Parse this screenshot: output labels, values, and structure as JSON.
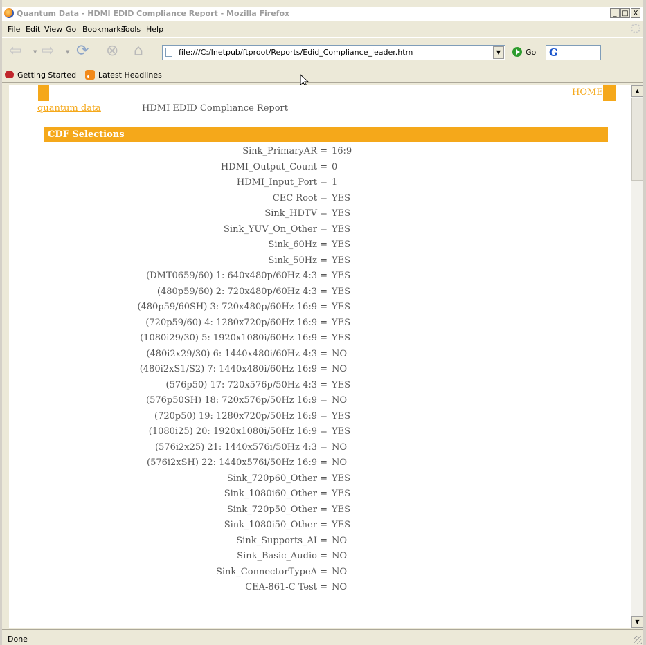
{
  "window": {
    "title": "Quantum Data - HDMI EDID Compliance Report - Mozilla Firefox",
    "controls": [
      "_",
      "□",
      "X"
    ]
  },
  "menu": [
    "File",
    "Edit",
    "View",
    "Go",
    "Bookmarks",
    "Tools",
    "Help"
  ],
  "toolbar": {
    "url": "file:///C:/Inetpub/ftproot/Reports/Edid_Compliance_leader.htm",
    "go_label": "Go",
    "search_logo": "G"
  },
  "bookmarks": [
    "Getting Started",
    "Latest Headlines"
  ],
  "page": {
    "home_link": "HOME",
    "brand": "quantum data",
    "report_title": "HDMI EDID Compliance Report",
    "section_title": "CDF Selections",
    "rows": [
      {
        "label": "Sink_PrimaryAR =",
        "value": "16:9"
      },
      {
        "label": "HDMI_Output_Count =",
        "value": "0"
      },
      {
        "label": "HDMI_Input_Port =",
        "value": "1"
      },
      {
        "label": "CEC Root =",
        "value": "YES"
      },
      {
        "label": "Sink_HDTV =",
        "value": "YES"
      },
      {
        "label": "Sink_YUV_On_Other =",
        "value": "YES"
      },
      {
        "label": "Sink_60Hz =",
        "value": "YES"
      },
      {
        "label": "Sink_50Hz =",
        "value": "YES"
      },
      {
        "label": "(DMT0659/60) 1: 640x480p/60Hz 4:3 =",
        "value": "YES"
      },
      {
        "label": "(480p59/60) 2: 720x480p/60Hz 4:3 =",
        "value": "YES"
      },
      {
        "label": "(480p59/60SH) 3: 720x480p/60Hz 16:9 =",
        "value": "YES"
      },
      {
        "label": "(720p59/60) 4: 1280x720p/60Hz 16:9 =",
        "value": "YES"
      },
      {
        "label": "(1080i29/30) 5: 1920x1080i/60Hz 16:9 =",
        "value": "YES"
      },
      {
        "label": "(480i2x29/30) 6: 1440x480i/60Hz 4:3 =",
        "value": "NO"
      },
      {
        "label": "(480i2xS1/S2) 7: 1440x480i/60Hz 16:9 =",
        "value": "NO"
      },
      {
        "label": "(576p50) 17: 720x576p/50Hz 4:3 =",
        "value": "YES"
      },
      {
        "label": "(576p50SH) 18: 720x576p/50Hz 16:9 =",
        "value": "NO"
      },
      {
        "label": "(720p50) 19: 1280x720p/50Hz 16:9 =",
        "value": "YES"
      },
      {
        "label": "(1080i25) 20: 1920x1080i/50Hz 16:9 =",
        "value": "YES"
      },
      {
        "label": "(576i2x25) 21: 1440x576i/50Hz 4:3 =",
        "value": "NO"
      },
      {
        "label": "(576i2xSH) 22: 1440x576i/50Hz 16:9 =",
        "value": "NO"
      },
      {
        "label": "Sink_720p60_Other =",
        "value": "YES"
      },
      {
        "label": "Sink_1080i60_Other =",
        "value": "YES"
      },
      {
        "label": "Sink_720p50_Other =",
        "value": "YES"
      },
      {
        "label": "Sink_1080i50_Other =",
        "value": "YES"
      },
      {
        "label": "Sink_Supports_AI =",
        "value": "NO"
      },
      {
        "label": "Sink_Basic_Audio =",
        "value": "NO"
      },
      {
        "label": "Sink_ConnectorTypeA =",
        "value": "NO"
      },
      {
        "label": "CEA-861-C Test =",
        "value": "NO"
      }
    ]
  },
  "status": "Done",
  "colors": {
    "accent": "#f5a81a",
    "text": "#555555",
    "chrome": "#ece9d8"
  }
}
